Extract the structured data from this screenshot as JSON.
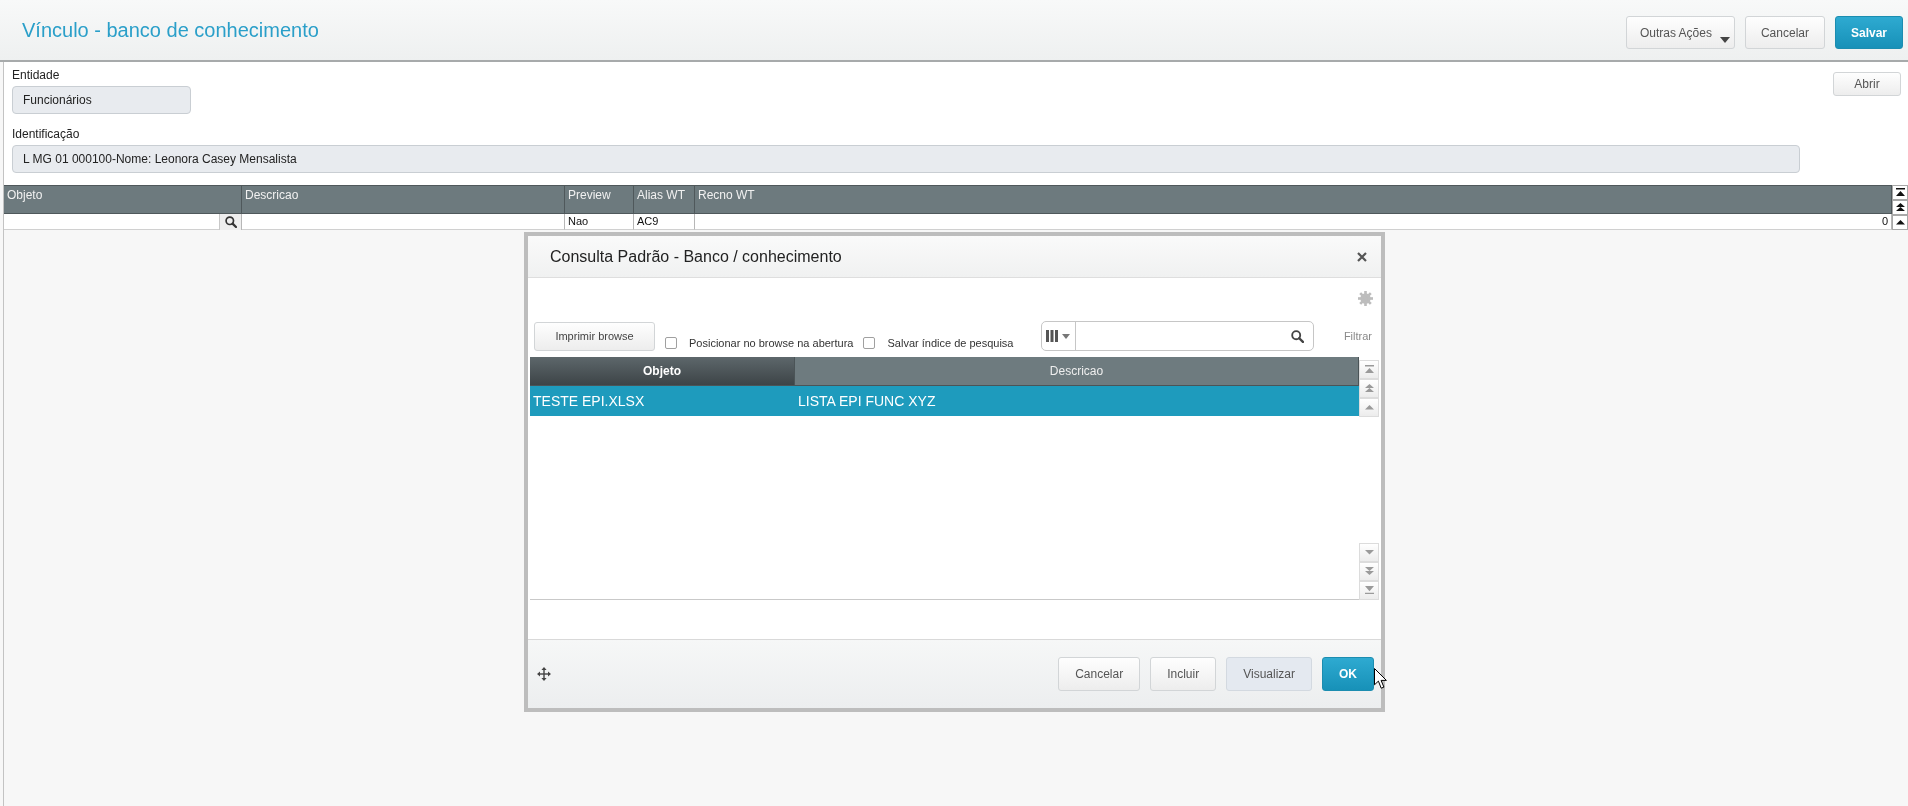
{
  "header": {
    "title": "Vínculo - banco de conhecimento",
    "buttons": [
      {
        "label": "Outras Ações",
        "kind": "dropdown"
      },
      {
        "label": "Cancelar",
        "kind": "default"
      },
      {
        "label": "Salvar",
        "kind": "primary"
      }
    ]
  },
  "form": {
    "entidade": {
      "label": "Entidade",
      "value": "Funcionários"
    },
    "identificacao": {
      "label": "Identificação",
      "value": "L MG 01 000100-Nome: Leonora Casey Mensalista"
    },
    "open_button": "Abrir"
  },
  "grid": {
    "columns": [
      "Objeto",
      "Descricao",
      "Preview",
      "Alias WT",
      "Recno WT"
    ],
    "rows": [
      {
        "preview": "Nao",
        "alias_wt": "AC9",
        "recno_wt": "0"
      }
    ]
  },
  "dialog": {
    "title": "Consulta Padrão - Banco / conhecimento",
    "print_button": "Imprimir browse",
    "options": [
      {
        "label": "Posicionar no browse na abertura",
        "checked": false
      },
      {
        "label": "Salvar índice de pesquisa",
        "checked": false
      }
    ],
    "filter_link": "Filtrar",
    "table": {
      "columns": [
        {
          "label": "Objeto",
          "sorted": true
        },
        {
          "label": "Descricao",
          "sorted": false
        }
      ],
      "rows": [
        {
          "cells": [
            "TESTE EPI.XLSX",
            "LISTA EPI FUNC XYZ"
          ],
          "selected": true
        }
      ]
    },
    "buttons": [
      {
        "label": "Cancelar",
        "kind": "default"
      },
      {
        "label": "Incluir",
        "kind": "default"
      },
      {
        "label": "Visualizar",
        "kind": "secondary"
      },
      {
        "label": "OK",
        "kind": "primary"
      }
    ]
  }
}
